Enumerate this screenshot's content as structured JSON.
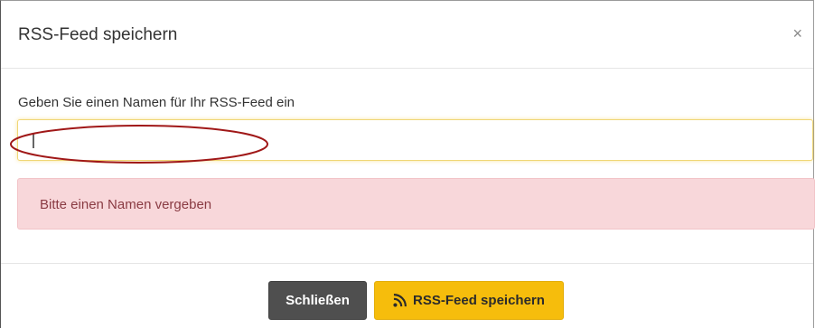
{
  "modal": {
    "title": "RSS-Feed speichern",
    "close_symbol": "×"
  },
  "form": {
    "label": "Geben Sie einen Namen für Ihr RSS-Feed ein",
    "name_input_value": "",
    "name_input_placeholder": ""
  },
  "alert": {
    "message": "Bitte einen Namen vergeben",
    "type": "danger"
  },
  "footer": {
    "close_label": "Schließen",
    "save_label": "RSS-Feed speichern",
    "save_icon": "rss-icon"
  },
  "colors": {
    "primary_button": "#f6bd0c",
    "secondary_button": "#4f4f4f",
    "alert_background": "#f8d7da",
    "alert_text": "#8a3b43",
    "highlight_ellipse": "#a01818"
  }
}
